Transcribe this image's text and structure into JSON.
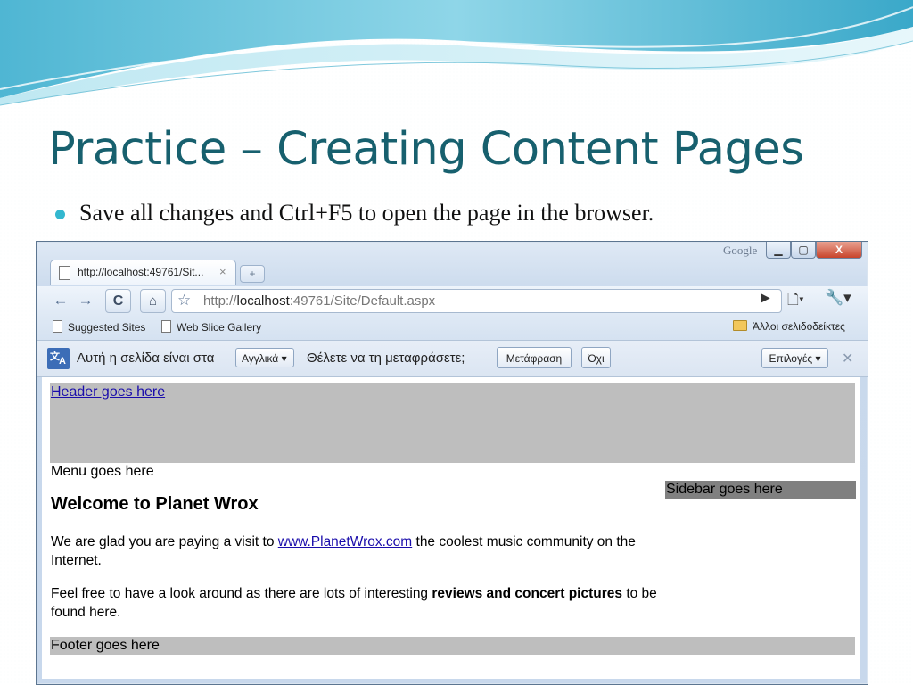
{
  "slide": {
    "title": "Practice – Creating Content Pages",
    "bullet": "Save all changes and Ctrl+F5 to open the page in the browser."
  },
  "browser": {
    "tab_title": "http://localhost:49761/Sit...",
    "tab_close": "×",
    "new_tab": "+",
    "google_label": "Google",
    "window_min": "▁",
    "window_max": "▢",
    "window_close": "X",
    "url_prefix": "http://",
    "url_host": "localhost",
    "url_rest": ":49761/Site/Default.aspx",
    "bookmarks": {
      "suggested_sites": "Suggested Sites",
      "web_slice_gallery": "Web Slice Gallery",
      "other_bookmarks": "Άλλοι σελιδοδείκτες"
    },
    "translate_bar": {
      "text_before": "Αυτή η σελίδα είναι στα",
      "language": "Αγγλικά",
      "question": "Θέλετε να τη μεταφράσετε;",
      "translate_button": "Μετάφραση",
      "no_button": "Όχι",
      "options_button": "Επιλογές",
      "close": "✕"
    }
  },
  "page": {
    "header_link": "Header goes here",
    "menu": "Menu goes here",
    "sidebar": "Sidebar goes here",
    "welcome_heading": "Welcome to Planet Wrox",
    "para1_before": "We are glad you are paying a visit to ",
    "para1_link": "www.PlanetWrox.com",
    "para1_after": " the coolest music community on the Internet.",
    "para2_before": "Feel free to have a look around as there are lots of interesting ",
    "para2_bold": "reviews and concert pictures",
    "para2_after": " to be found here.",
    "footer": "Footer goes here"
  },
  "colors": {
    "title": "#17606e",
    "bullet": "#33b7cf",
    "header_bg": "#bebebe",
    "sidebar_bg": "#808080",
    "footer_bg": "#bebebe",
    "link": "#1a0dab"
  }
}
